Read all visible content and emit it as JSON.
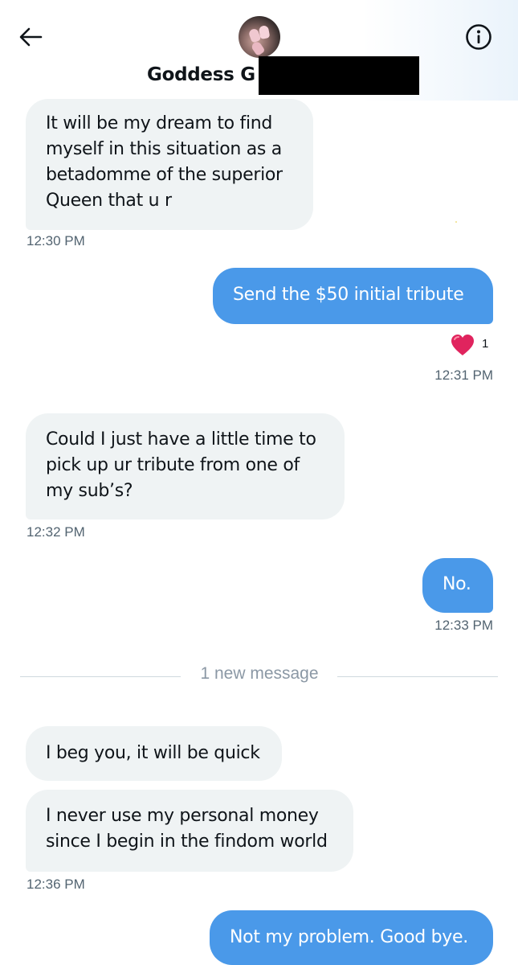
{
  "header": {
    "contact_name": "Goddess G",
    "back_icon": "arrow-left-icon",
    "info_icon": "info-circle-icon"
  },
  "messages": [
    {
      "direction": "incoming",
      "text": "It will be my dream to find\nmyself in this situation as a\nbetadomme of the superior\nQueen that u r",
      "time": "12:30 PM"
    },
    {
      "direction": "outgoing",
      "text": "Send the $50 initial tribute",
      "reaction": {
        "emoji": "❤️",
        "count": "1"
      },
      "time": "12:31 PM"
    },
    {
      "direction": "incoming",
      "text": "Could I just have a little time to\npick up ur tribute from one of\nmy sub’s?",
      "time": "12:32 PM"
    },
    {
      "direction": "outgoing",
      "text": "No.",
      "time": "12:33 PM"
    },
    {
      "direction": "incoming",
      "text": "I beg you, it will be quick"
    },
    {
      "direction": "incoming",
      "text": "I never use my personal money\nsince I begin in the findom world",
      "time": "12:36 PM"
    },
    {
      "direction": "outgoing",
      "text": "Not my problem. Good bye."
    }
  ],
  "divider": {
    "label": "1 new message"
  },
  "colors": {
    "outgoing_bubble": "#4a99e9",
    "incoming_bubble": "#eff3f4",
    "timestamp": "#536471",
    "reaction_heart": "#e0245e"
  }
}
